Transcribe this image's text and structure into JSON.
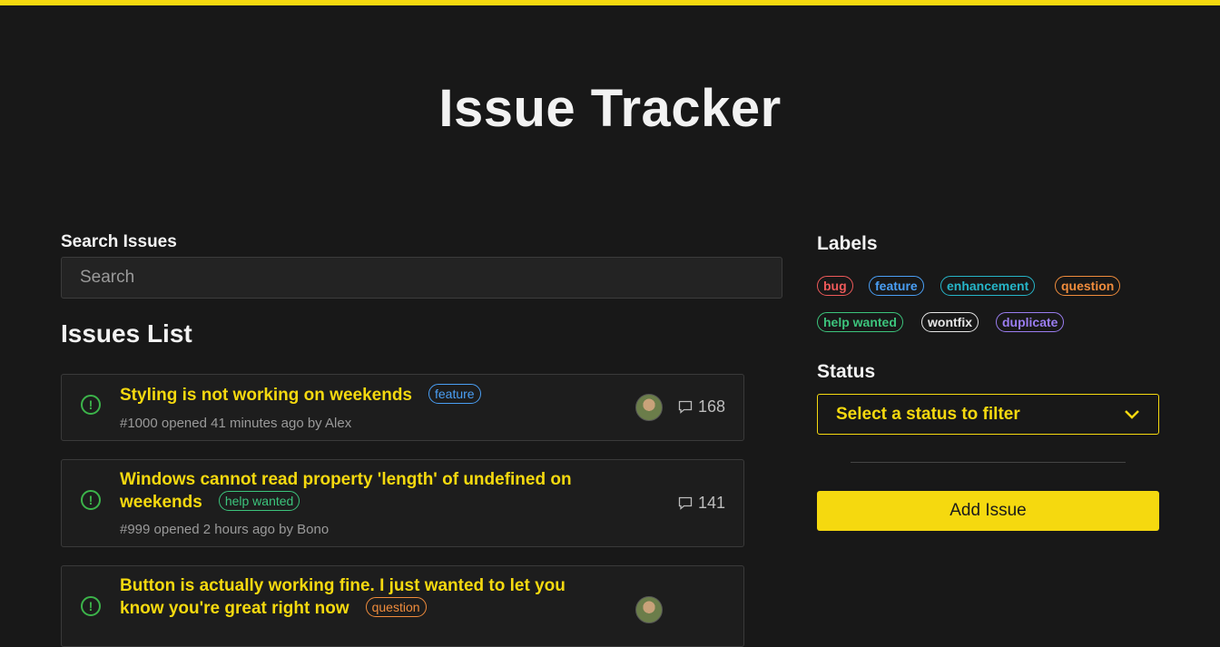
{
  "header": {
    "title": "Issue Tracker"
  },
  "search": {
    "label": "Search Issues",
    "placeholder": "Search",
    "value": ""
  },
  "issues_heading": "Issues List",
  "issues": [
    {
      "title": "Styling is not working on weekends",
      "label": "feature",
      "meta": "#1000 opened 41 minutes ago by Alex",
      "comments": "168",
      "has_avatar": true
    },
    {
      "title": "Windows cannot read property 'length' of undefined on weekends",
      "label": "help wanted",
      "meta": "#999 opened 2 hours ago by Bono",
      "comments": "141",
      "has_avatar": false
    },
    {
      "title": "Button is actually working fine. I just wanted to let you know you're great right now",
      "label": "question",
      "meta": "",
      "comments": "",
      "has_avatar": true
    }
  ],
  "sidebar": {
    "labels_heading": "Labels",
    "labels": [
      {
        "name": "bug",
        "color": "#ef5a5a"
      },
      {
        "name": "feature",
        "color": "#4a9ff5"
      },
      {
        "name": "enhancement",
        "color": "#26b5c8"
      },
      {
        "name": "question",
        "color": "#f08c3c"
      },
      {
        "name": "help wanted",
        "color": "#3cc47c"
      },
      {
        "name": "wontfix",
        "color": "#e6e6e6"
      },
      {
        "name": "duplicate",
        "color": "#9a7df0"
      }
    ],
    "status_heading": "Status",
    "status_select": "Select a status to filter",
    "add_button": "Add Issue"
  },
  "colors": {
    "accent": "#f5d90f",
    "background": "#181818",
    "open_icon": "#3cb44a"
  }
}
